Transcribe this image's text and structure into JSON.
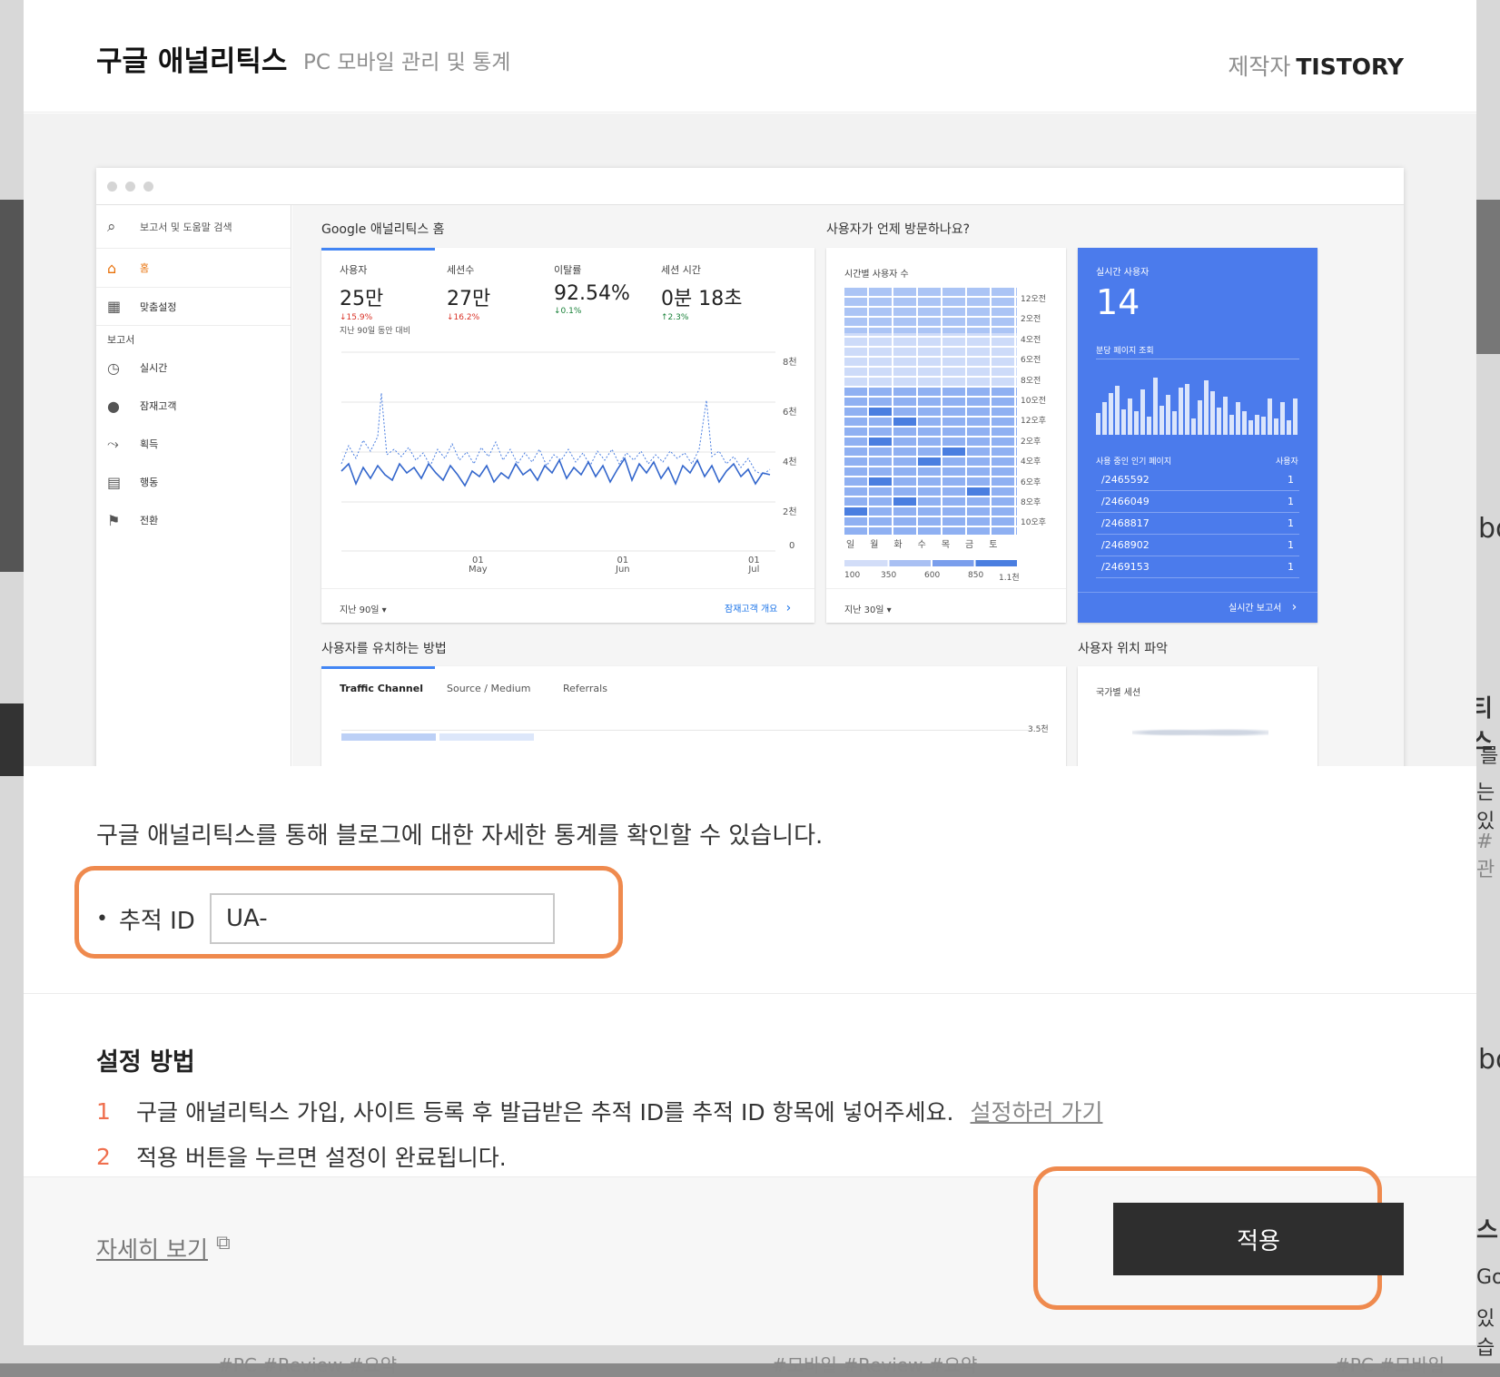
{
  "header": {
    "title": "구글 애널리틱스",
    "subtitle": "PC 모바일 관리 및 통계",
    "maker_label": "제작자",
    "maker_name": "TISTORY"
  },
  "preview": {
    "search_placeholder": "보고서 및 도움말 검색",
    "sidebar": [
      {
        "label": "홈",
        "icon": "home-icon"
      },
      {
        "label": "맞춤설정",
        "icon": "dashboard-icon"
      }
    ],
    "sidebar_group": "보고서",
    "reports": [
      {
        "label": "실시간",
        "icon": "clock-icon"
      },
      {
        "label": "잠재고객",
        "icon": "person-icon"
      },
      {
        "label": "획득",
        "icon": "acquisition-icon"
      },
      {
        "label": "행동",
        "icon": "behavior-icon"
      },
      {
        "label": "전환",
        "icon": "flag-icon"
      }
    ],
    "home_title": "Google 애널리틱스 홈",
    "when_title": "사용자가 언제 방문하나요?",
    "kpis": [
      {
        "label": "사용자",
        "value": "25만",
        "delta": "↓15.9%",
        "dir": "down"
      },
      {
        "label": "세션수",
        "value": "27만",
        "delta": "↓16.2%",
        "dir": "down"
      },
      {
        "label": "이탈률",
        "value": "92.54%",
        "delta": "↓0.1%",
        "dir": "up"
      },
      {
        "label": "세션 시간",
        "value": "0분 18초",
        "delta": "↑2.3%",
        "dir": "up"
      }
    ],
    "compare_text": "지난 90일 동안 대비",
    "y_ticks": [
      "8천",
      "6천",
      "4천",
      "2천",
      "0"
    ],
    "x_ticks": [
      {
        "d": "01",
        "m": "May"
      },
      {
        "d": "01",
        "m": "Jun"
      },
      {
        "d": "01",
        "m": "Jul"
      }
    ],
    "range_left": "지난 90일 ▾",
    "audience_link": "잠재고객 개요",
    "heat_title": "시간별 사용자 수",
    "heat_hours": [
      "12오전",
      "2오전",
      "4오전",
      "6오전",
      "8오전",
      "10오전",
      "12오후",
      "2오후",
      "4오후",
      "6오후",
      "8오후",
      "10오후"
    ],
    "heat_days": [
      "일",
      "월",
      "화",
      "수",
      "목",
      "금",
      "토"
    ],
    "heat_legend": [
      "100",
      "350",
      "600",
      "850",
      "1.1천"
    ],
    "heat_range": "지난 30일 ▾",
    "rt_title": "실시간 사용자",
    "rt_value": "14",
    "rt_sub": "분당 페이지 조회",
    "rt_col1": "사용 중인 인기 페이지",
    "rt_col2": "사용자",
    "rt_rows": [
      {
        "p": "/2465592",
        "v": "1"
      },
      {
        "p": "/2466049",
        "v": "1"
      },
      {
        "p": "/2468817",
        "v": "1"
      },
      {
        "p": "/2468902",
        "v": "1"
      },
      {
        "p": "/2469153",
        "v": "1"
      }
    ],
    "rt_link": "실시간 보고서",
    "acq_title": "사용자를 유치하는 방법",
    "acq_tabs": [
      "Traffic Channel",
      "Source / Medium",
      "Referrals"
    ],
    "acq_tick": "3.5천",
    "geo_title": "사용자 위치 파악",
    "geo_sub": "국가별 세션"
  },
  "content": {
    "description": "구글 애널리틱스를 통해 블로그에 대한 자세한 통계를 확인할 수 있습니다.",
    "field_label": "추적 ID",
    "field_value": "UA-",
    "howto_title": "설정 방법",
    "steps": [
      {
        "n": "1",
        "text": "구글 애널리틱스 가입, 사이트 등록 후 발급받은 추적 ID를 추적 ID 항목에 넣어주세요.",
        "link": "설정하러 가기"
      },
      {
        "n": "2",
        "text": "적용 버튼을 누르면 설정이 완료됩니다."
      }
    ]
  },
  "footer": {
    "more_label": "자세히 보기",
    "apply_label": "적용"
  },
  "background": {
    "right_fragments": [
      "bo",
      "티스",
      "를",
      "는 있",
      "#관",
      "bo",
      "스",
      "Go",
      "있습"
    ],
    "bottom_fragments": [
      "#PC  #Review  #요약",
      "#모바일  #Review  #요약",
      "#PC  #모바일"
    ]
  },
  "colors": {
    "accent": "#ef8a4e",
    "apply_bg": "#2e2e2e",
    "ga_blue": "#4b7bec",
    "step_number": "#ef6f4e"
  }
}
